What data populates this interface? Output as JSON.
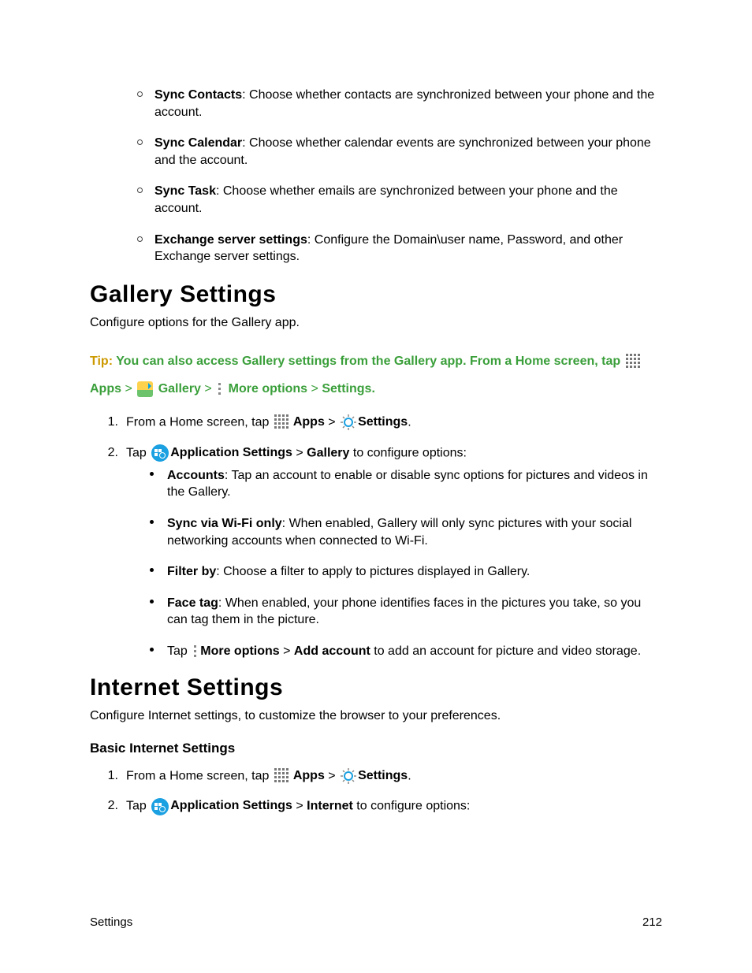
{
  "syncList": [
    {
      "label": "Sync Contacts",
      "desc": ": Choose whether contacts are synchronized between your phone and the account."
    },
    {
      "label": "Sync Calendar",
      "desc": ": Choose whether calendar events are synchronized between your phone and the account."
    },
    {
      "label": "Sync Task",
      "desc": ": Choose whether emails are synchronized between your phone and the account."
    },
    {
      "label": "Exchange server settings",
      "desc": ": Configure the Domain\\user name, Password, and other Exchange server settings."
    }
  ],
  "gallery": {
    "heading": "Gallery Settings",
    "intro": "Configure options for the Gallery app.",
    "tip": {
      "label": "Tip:",
      "pre": " You can also access Gallery settings from the Gallery app. From a Home screen, tap ",
      "apps": "Apps",
      "gallery": "Gallery",
      "more": "More options",
      "settings": "Settings",
      "period": "."
    },
    "step1_pre": "From a Home screen, tap ",
    "apps_bold": "Apps",
    "settings_bold": "Settings",
    "step1_post": ".",
    "step2_pre": "Tap ",
    "appset_bold": "Application Settings",
    "gallery_bold": "Gallery",
    "step2_post": " to configure options:",
    "options": {
      "accounts": {
        "label": "Accounts",
        "desc": ": Tap an account to enable or disable sync options for pictures and videos in the Gallery."
      },
      "wifi": {
        "label": "Sync via Wi-Fi only",
        "desc": ": When enabled, Gallery will only sync pictures with your social networking accounts when connected to Wi-Fi."
      },
      "filter": {
        "label": "Filter by",
        "desc": ": Choose a filter to apply to pictures displayed in Gallery."
      },
      "face": {
        "label": "Face tag",
        "desc": ": When enabled, your phone identifies faces in the pictures you take, so you can tag them in the picture."
      },
      "more": {
        "pre": "Tap ",
        "more_bold": "More options",
        "add_bold": "Add account",
        "post": " to add an account for picture and video storage."
      }
    }
  },
  "internet": {
    "heading": "Internet Settings",
    "intro": "Configure Internet settings, to customize the browser to your preferences.",
    "subheading": "Basic Internet Settings",
    "step1_pre": "From a Home screen, tap ",
    "apps_bold": "Apps",
    "settings_bold": "Settings",
    "step1_post": ".",
    "step2_pre": "Tap ",
    "appset_bold": "Application Settings",
    "internet_bold": "Internet",
    "step2_post": " to configure options:"
  },
  "footer": {
    "section": "Settings",
    "page": "212"
  },
  "gt": " > "
}
